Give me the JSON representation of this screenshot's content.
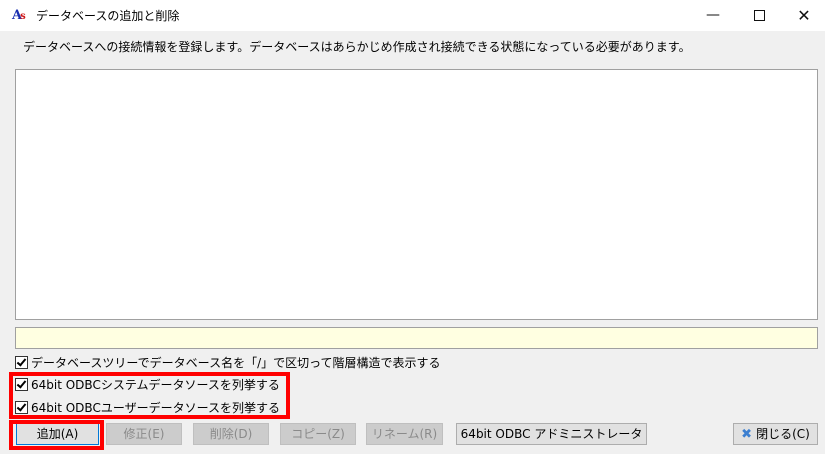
{
  "window": {
    "title": "データベースの追加と削除",
    "icon": "app-logo-icon",
    "controls": {
      "minimize": "—",
      "maximize": "",
      "close": "✕"
    }
  },
  "description": "データベースへの接続情報を登録します。データベースはあらかじめ作成され接続できる状態になっている必要があります。",
  "database_list": {
    "items": []
  },
  "status_text": "",
  "options": [
    {
      "label": "データベースツリーでデータベース名を「/」で区切って階層構造で表示する",
      "checked": true
    },
    {
      "label": "64bit ODBCシステムデータソースを列挙する",
      "checked": true
    },
    {
      "label": "64bit ODBCユーザーデータソースを列挙する",
      "checked": true
    }
  ],
  "buttons": {
    "add": "追加(A)",
    "edit": "修正(E)",
    "delete": "削除(D)",
    "copy": "コピー(Z)",
    "rename": "リネーム(R)",
    "odbc_admin": "64bit ODBC アドミニストレータ",
    "close": "閉じる(C)"
  },
  "close_icon": "close-x-icon",
  "colors": {
    "highlight": "#ff0000",
    "status_bg": "#ffffe1",
    "focus_border": "#0078d7"
  }
}
